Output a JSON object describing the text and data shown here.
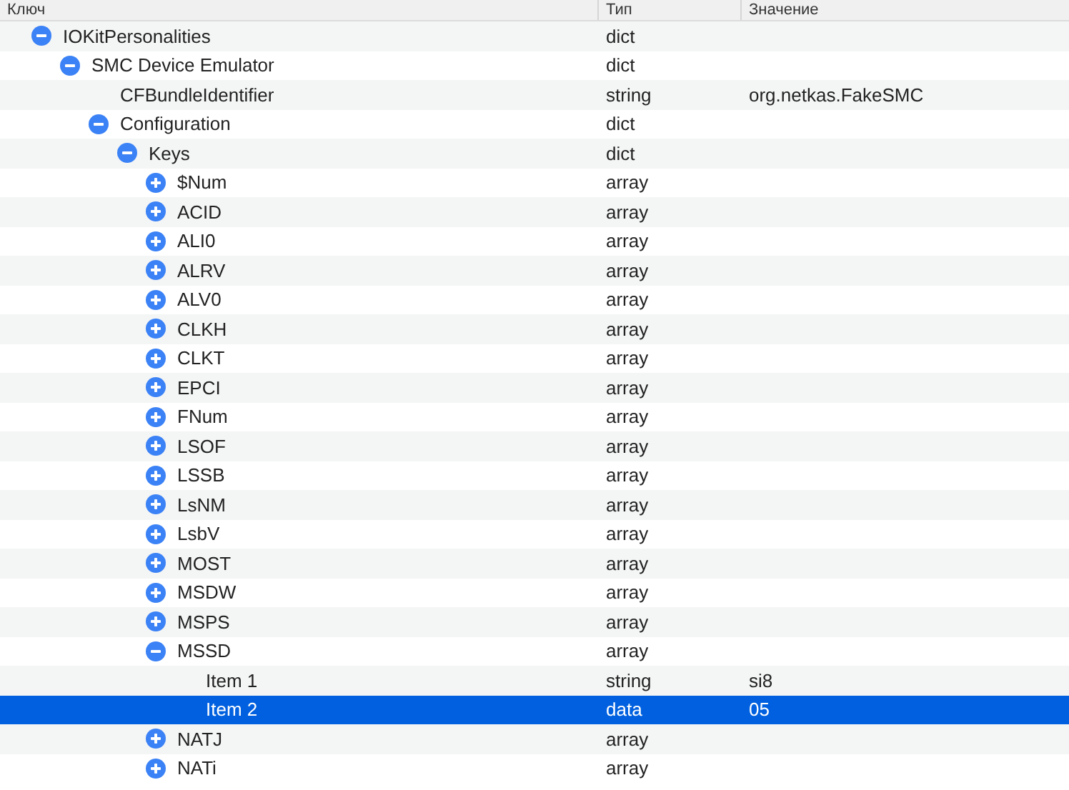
{
  "table": {
    "columns": [
      "Ключ",
      "Тип",
      "Значение"
    ],
    "rows": [
      {
        "key": "IOKitPersonalities",
        "type": "dict",
        "expanded": true,
        "selected": false,
        "children": [
          {
            "key": "SMC Device Emulator",
            "type": "dict",
            "expanded": true,
            "selected": false,
            "children": [
              {
                "key": "CFBundleIdentifier",
                "type": "string",
                "value": "org.netkas.FakeSMC",
                "selected": false
              },
              {
                "key": "Configuration",
                "type": "dict",
                "expanded": true,
                "selected": false,
                "children": [
                  {
                    "key": "Keys",
                    "type": "dict",
                    "expanded": true,
                    "selected": false,
                    "children": [
                      {
                        "key": "$Num",
                        "type": "array",
                        "expanded": false,
                        "selected": false
                      },
                      {
                        "key": "ACID",
                        "type": "array",
                        "expanded": false,
                        "selected": false
                      },
                      {
                        "key": "ALI0",
                        "type": "array",
                        "expanded": false,
                        "selected": false
                      },
                      {
                        "key": "ALRV",
                        "type": "array",
                        "expanded": false,
                        "selected": false
                      },
                      {
                        "key": "ALV0",
                        "type": "array",
                        "expanded": false,
                        "selected": false
                      },
                      {
                        "key": "CLKH",
                        "type": "array",
                        "expanded": false,
                        "selected": false
                      },
                      {
                        "key": "CLKT",
                        "type": "array",
                        "expanded": false,
                        "selected": false
                      },
                      {
                        "key": "EPCI",
                        "type": "array",
                        "expanded": false,
                        "selected": false
                      },
                      {
                        "key": "FNum",
                        "type": "array",
                        "expanded": false,
                        "selected": false
                      },
                      {
                        "key": "LSOF",
                        "type": "array",
                        "expanded": false,
                        "selected": false
                      },
                      {
                        "key": "LSSB",
                        "type": "array",
                        "expanded": false,
                        "selected": false
                      },
                      {
                        "key": "LsNM",
                        "type": "array",
                        "expanded": false,
                        "selected": false
                      },
                      {
                        "key": "LsbV",
                        "type": "array",
                        "expanded": false,
                        "selected": false
                      },
                      {
                        "key": "MOST",
                        "type": "array",
                        "expanded": false,
                        "selected": false
                      },
                      {
                        "key": "MSDW",
                        "type": "array",
                        "expanded": false,
                        "selected": false
                      },
                      {
                        "key": "MSPS",
                        "type": "array",
                        "expanded": false,
                        "selected": false
                      },
                      {
                        "key": "MSSD",
                        "type": "array",
                        "expanded": true,
                        "selected": false,
                        "children": [
                          {
                            "key": "Item 1",
                            "type": "string",
                            "value": "si8",
                            "selected": false
                          },
                          {
                            "key": "Item 2",
                            "type": "data",
                            "value": "05",
                            "selected": true
                          }
                        ]
                      },
                      {
                        "key": "NATJ",
                        "type": "array",
                        "expanded": false,
                        "selected": false
                      },
                      {
                        "key": "NATi",
                        "type": "array",
                        "expanded": false,
                        "selected": false
                      }
                    ]
                  }
                ]
              }
            ]
          }
        ]
      }
    ]
  }
}
